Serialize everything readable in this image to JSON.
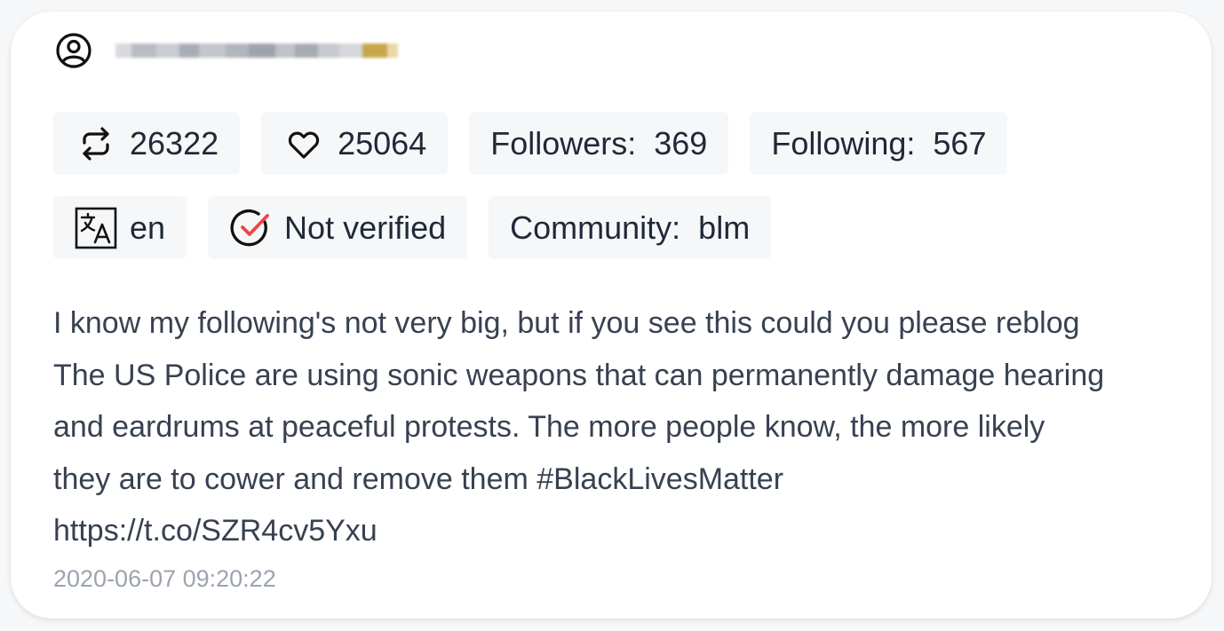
{
  "post": {
    "user": {
      "avatar_icon": "user-circle-icon",
      "username_redacted": true
    },
    "stats": {
      "retweets": "26322",
      "likes": "25064",
      "followers_label": "Followers:  369",
      "following_label": "Following:  567"
    },
    "meta": {
      "language": "en",
      "verified_label": "Not verified",
      "community_label": "Community:  blm"
    },
    "text": "I know my following's not very big, but if you see this could you please reblog\nThe US Police are using sonic weapons that can permanently damage hearing\nand eardrums at peaceful protests. The more people know, the more likely\nthey are to cower and remove them #BlackLivesMatter\nhttps://t.co/SZR4cv5Yxu",
    "timestamp": "2020-06-07 09:20:22",
    "colors": {
      "chip_background": "#f6f7f9",
      "check_accent": "#ef4444",
      "text": "#374151",
      "timestamp": "#9ca3af"
    },
    "icons": {
      "retweet": "retweet-icon",
      "like": "heart-icon",
      "language": "translate-icon",
      "verified": "check-circle-icon"
    }
  }
}
